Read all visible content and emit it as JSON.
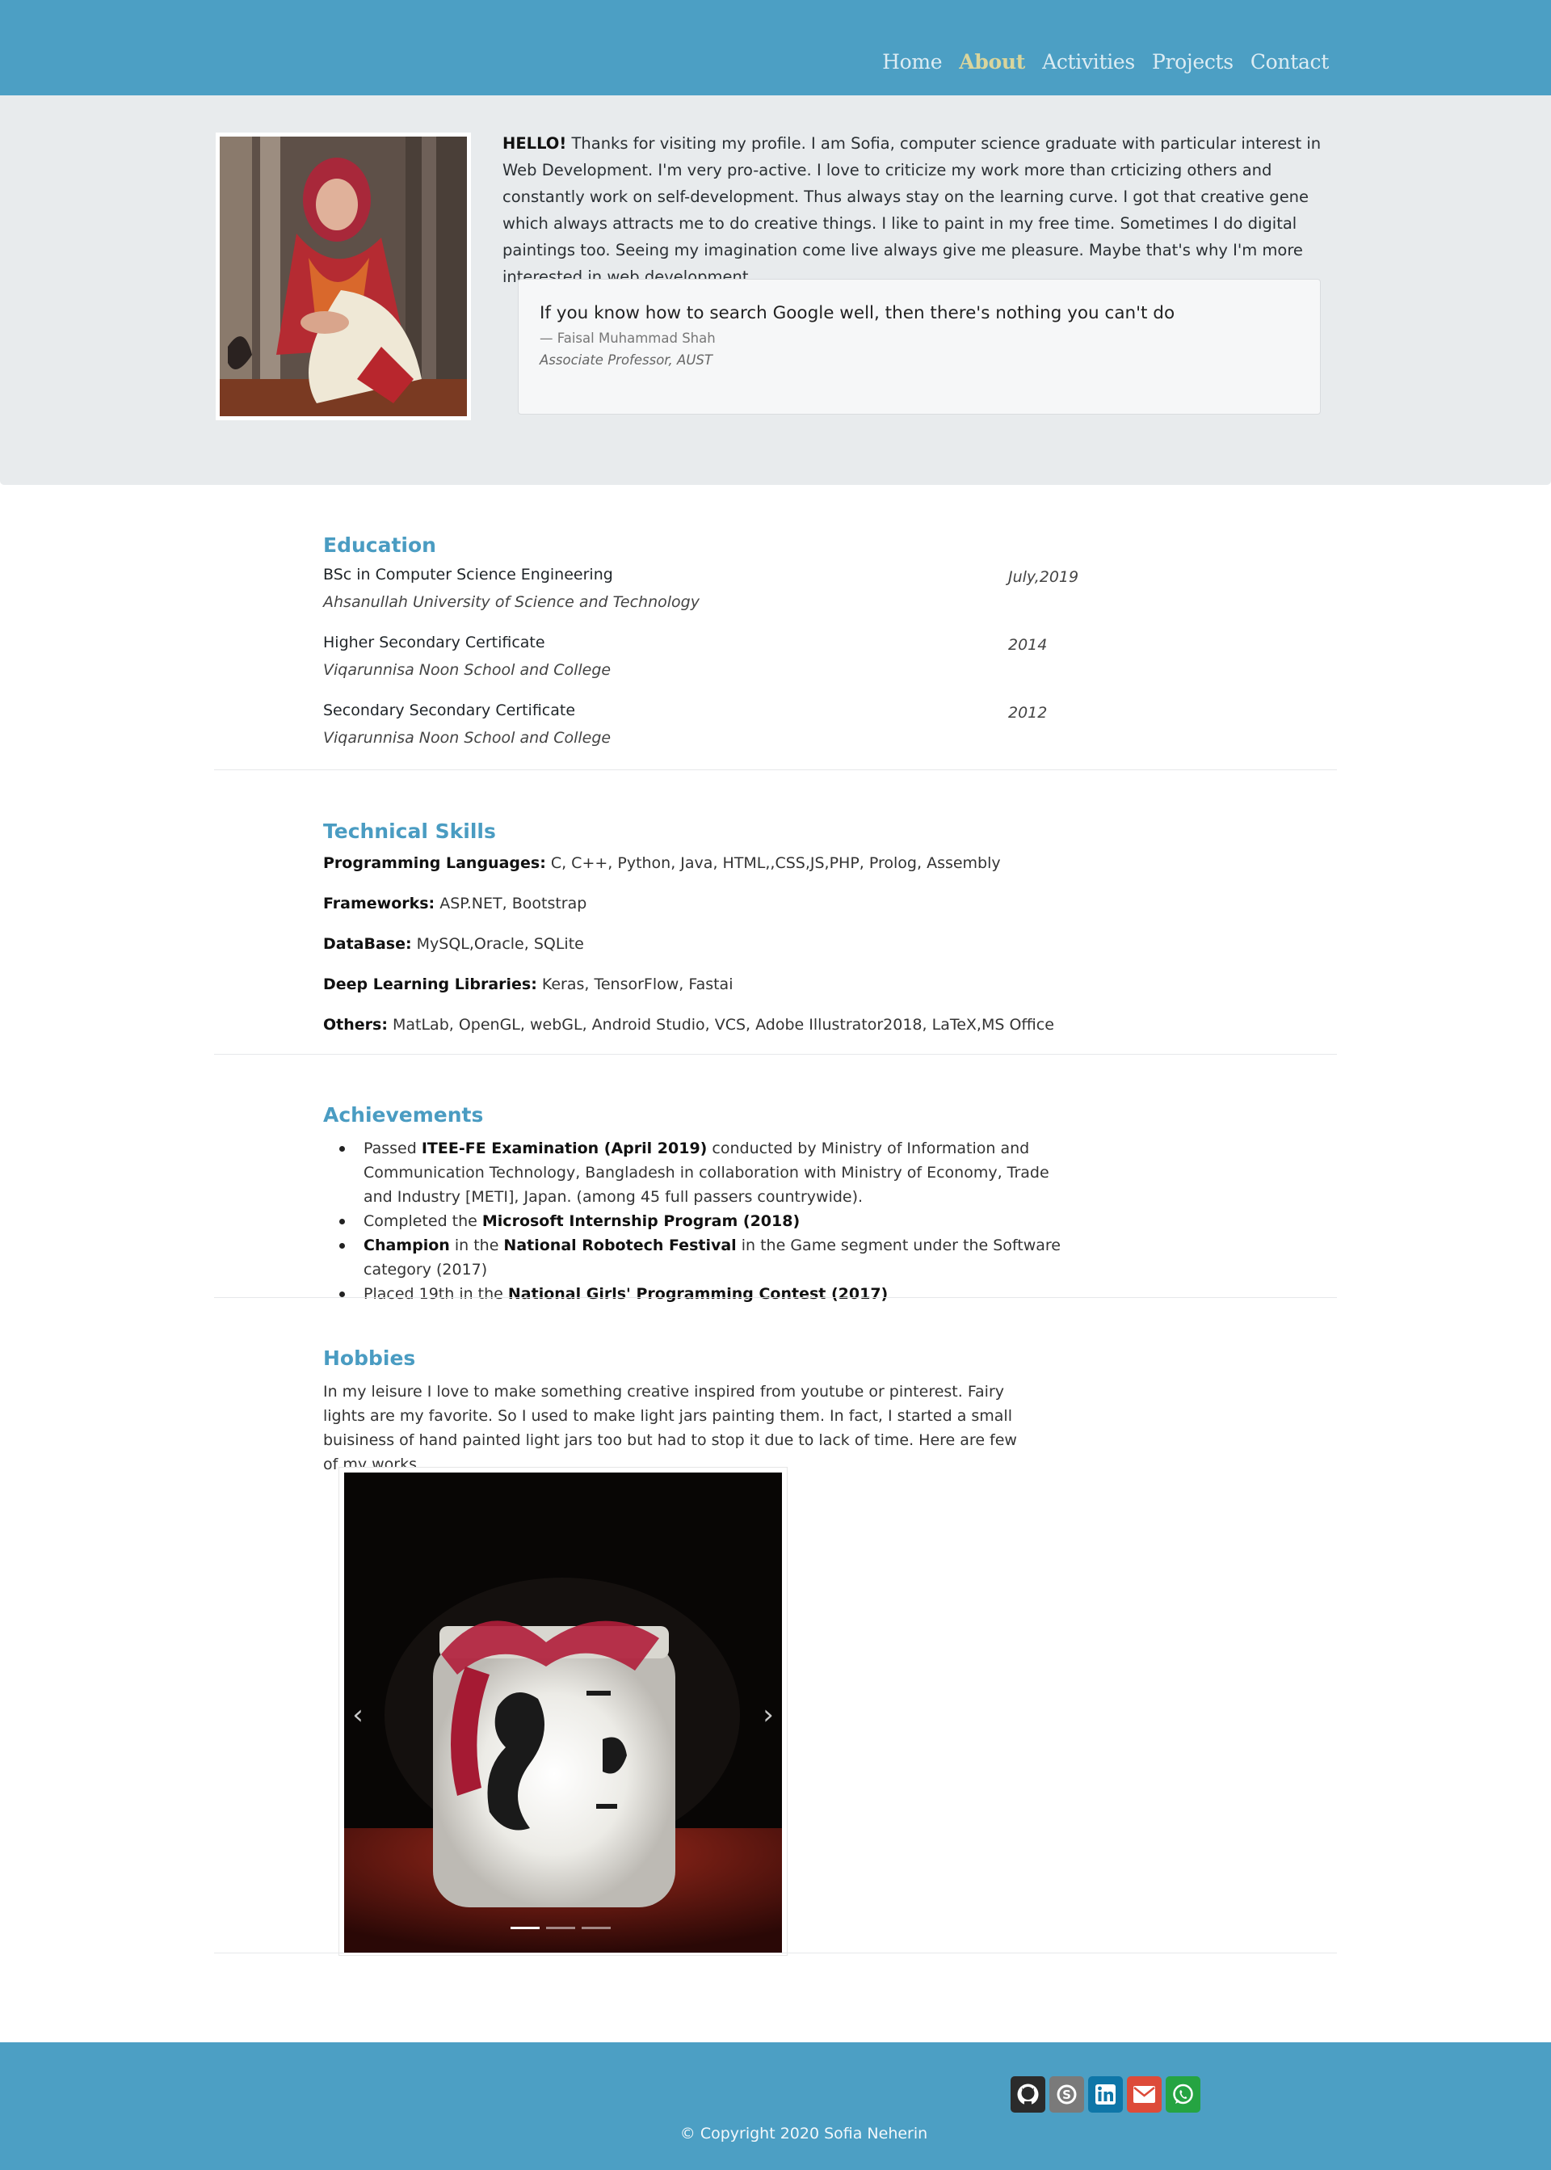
{
  "nav": {
    "items": [
      {
        "label": "Home",
        "active": false
      },
      {
        "label": "About",
        "active": true
      },
      {
        "label": "Activities",
        "active": false
      },
      {
        "label": "Projects",
        "active": false
      },
      {
        "label": "Contact",
        "active": false
      }
    ]
  },
  "hero": {
    "greeting": "HELLO!",
    "intro": " Thanks for visiting my profile. I am Sofia, computer science graduate with particular interest in Web Development. I'm very pro-active. I love to criticize my work more than crticizing others and constantly work on self-development. Thus always stay on the learning curve. I got that creative gene which always attracts me to do creative things. I like to paint in my free time. Sometimes I do digital paintings too. Seeing my imagination come live always give me pleasure. Maybe that's why I'm more interested in web development.",
    "quote": {
      "text": "If you know how to search Google well, then there's nothing you can't do",
      "author": "— Faisal Muhammad Shah",
      "title": "Associate Professor, AUST"
    }
  },
  "education": {
    "title": "Education",
    "items": [
      {
        "degree": "BSc in Computer Science Engineering",
        "school": "Ahsanullah University of Science and Technology",
        "date": "July,2019"
      },
      {
        "degree": "Higher Secondary Certificate",
        "school": "Viqarunnisa Noon School and College",
        "date": "2014"
      },
      {
        "degree": "Secondary Secondary Certificate",
        "school": "Viqarunnisa Noon School and College",
        "date": "2012"
      }
    ]
  },
  "skills": {
    "title": "Technical Skills",
    "items": [
      {
        "label": "Programming Languages:",
        "value": " C, C++, Python, Java, HTML,,CSS,JS,PHP, Prolog, Assembly"
      },
      {
        "label": "Frameworks:",
        "value": " ASP.NET, Bootstrap"
      },
      {
        "label": "DataBase:",
        "value": " MySQL,Oracle, SQLite"
      },
      {
        "label": "Deep Learning Libraries:",
        "value": " Keras, TensorFlow, Fastai"
      },
      {
        "label": "Others:",
        "value": " MatLab, OpenGL, webGL, Android Studio, VCS, Adobe Illustrator2018, LaTeX,MS Office"
      }
    ]
  },
  "achievements": {
    "title": "Achievements",
    "item1": {
      "a": "Passed ",
      "b": "ITEE-FE Examination (April 2019)",
      "c": " conducted by Ministry of Information and Communication Technology, Bangladesh in collaboration with Ministry of Economy, Trade and Industry [METI], Japan. (among 45 full passers countrywide)."
    },
    "item2": {
      "a": "Completed the ",
      "b": "Microsoft Internship Program (2018)"
    },
    "item3": {
      "a": "Champion",
      "b": " in the ",
      "c": "National Robotech Festival",
      "d": " in the Game segment under the Software category (2017)"
    },
    "item4": {
      "a": "Placed 19th in the ",
      "b": "National Girls' Programming Contest (2017)"
    }
  },
  "hobbies": {
    "title": "Hobbies",
    "text": "In my leisure I love to make something creative inspired from youtube or pinterest. Fairy lights are my favorite. So I used to make light jars painting them. In fact, I started a small buisiness of hand painted light jars too but had to stop it due to lack of time. Here are few of my works.",
    "carousel": {
      "slides": 3,
      "active": 0
    }
  },
  "footer": {
    "social": [
      "github-icon",
      "skype-icon",
      "linkedin-icon",
      "mail-icon",
      "whatsapp-icon"
    ],
    "social_colors": [
      "#2b2b2b",
      "#7a7a7a",
      "#0e76a8",
      "#dd4b39",
      "#25a442"
    ],
    "copyright": "© Copyright 2020 Sofia Neherin"
  },
  "colors": {
    "brand": "#4c9fc4",
    "heading": "#4a9cc2",
    "active_nav": "#d9d59c"
  }
}
